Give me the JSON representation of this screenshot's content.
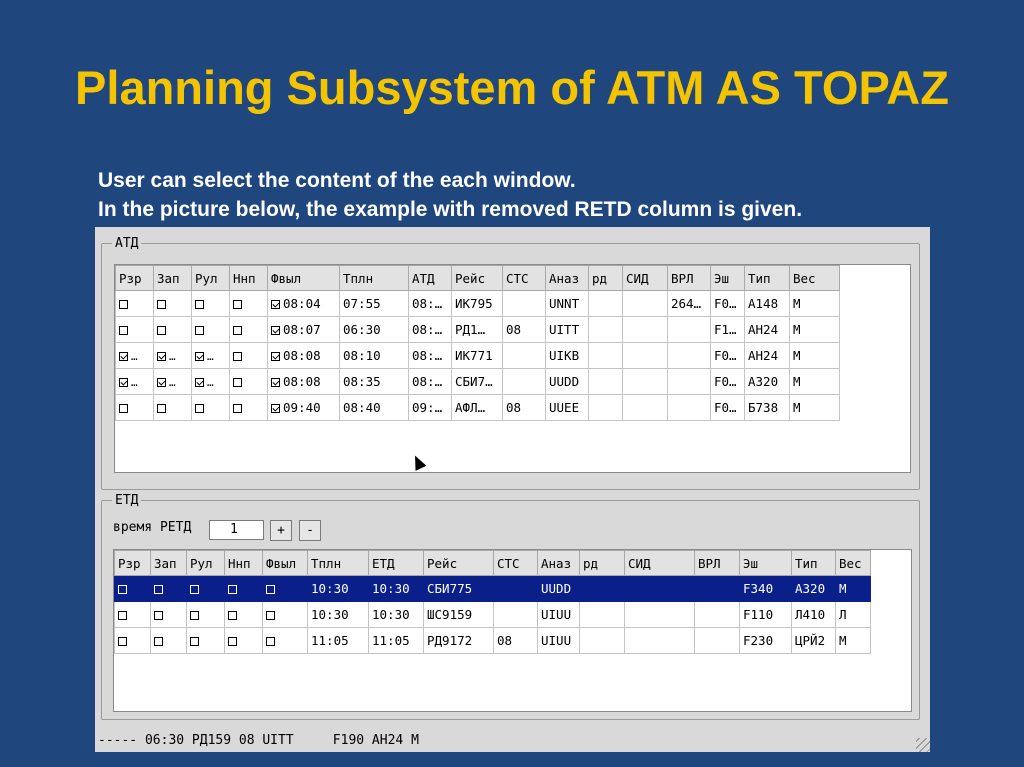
{
  "slide": {
    "title": "Planning Subsystem of ATM AS TOPAZ",
    "line1": "User can select the content of the each window.",
    "line2": "In the picture below, the example with removed RETD column is given."
  },
  "atd": {
    "legend": "АТД",
    "columns": [
      "Рзр",
      "Зап",
      "Рул",
      "Ннп",
      "Фвыл",
      "Тплн",
      "АТД",
      "Рейс",
      "СТС",
      "Аназ",
      "рд",
      "СИД",
      "ВРЛ",
      "Эш",
      "Тип",
      "Вес"
    ],
    "rows": [
      {
        "rzr": false,
        "zap": false,
        "rul": false,
        "nnp": false,
        "fvyl": "08:04",
        "tpln": "07:55",
        "atd": "08:…",
        "reys": "ИК795",
        "sts": "",
        "anaz": "UNNT",
        "rd": "",
        "sid": "",
        "vrl": "264…",
        "esh": "F0…",
        "tip": "A148",
        "ves": "М"
      },
      {
        "rzr": false,
        "zap": false,
        "rul": false,
        "nnp": false,
        "fvyl": "08:07",
        "tpln": "06:30",
        "atd": "08:…",
        "reys": "РД1…",
        "sts": "08",
        "anaz": "UITT",
        "rd": "",
        "sid": "",
        "vrl": "",
        "esh": "F1…",
        "tip": "АН24",
        "ves": "М"
      },
      {
        "rzr": true,
        "zap": true,
        "rul": true,
        "nnp": false,
        "fvyl": "08:08",
        "tpln": "08:10",
        "atd": "08:…",
        "reys": "ИК771",
        "sts": "",
        "anaz": "UIKB",
        "rd": "",
        "sid": "",
        "vrl": "",
        "esh": "F0…",
        "tip": "АН24",
        "ves": "М"
      },
      {
        "rzr": true,
        "zap": true,
        "rul": true,
        "nnp": false,
        "fvyl": "08:08",
        "tpln": "08:35",
        "atd": "08:…",
        "reys": "СБИ7…",
        "sts": "",
        "anaz": "UUDD",
        "rd": "",
        "sid": "",
        "vrl": "",
        "esh": "F0…",
        "tip": "A320",
        "ves": "М"
      },
      {
        "rzr": false,
        "zap": false,
        "rul": false,
        "nnp": false,
        "fvyl": "09:40",
        "tpln": "08:40",
        "atd": "09:…",
        "reys": "АФЛ…",
        "sts": "08",
        "anaz": "UUEE",
        "rd": "",
        "sid": "",
        "vrl": "",
        "esh": "F0…",
        "tip": "Б738",
        "ves": "М"
      }
    ]
  },
  "etd": {
    "legend": "ЕТД",
    "retd_label": "время РЕТД",
    "retd_value": "1",
    "plus": "+",
    "minus": "-",
    "columns": [
      "Рзр",
      "Зап",
      "Рул",
      "Ннп",
      "Фвыл",
      "Тплн",
      "ЕТД",
      "Рейс",
      "СТС",
      "Аназ",
      "рд",
      "СИД",
      "ВРЛ",
      "Эш",
      "Тип",
      "Вес"
    ],
    "rows": [
      {
        "tpln": "10:30",
        "etd": "10:30",
        "reys": "СБИ775",
        "sts": "",
        "anaz": "UUDD",
        "rd": "",
        "sid": "",
        "vrl": "",
        "esh": "F340",
        "tip": "A320",
        "ves": "М",
        "selected": true
      },
      {
        "tpln": "10:30",
        "etd": "10:30",
        "reys": "ШС9159",
        "sts": "",
        "anaz": "UIUU",
        "rd": "",
        "sid": "",
        "vrl": "",
        "esh": "F110",
        "tip": "Л410",
        "ves": "Л",
        "selected": false
      },
      {
        "tpln": "11:05",
        "etd": "11:05",
        "reys": "РД9172",
        "sts": "08",
        "anaz": "UIUU",
        "rd": "",
        "sid": "",
        "vrl": "",
        "esh": "F230",
        "tip": "ЦРЙ2",
        "ves": "М",
        "selected": false
      }
    ]
  },
  "status": "----- 06:30 РД159 08 UITT     F190 АН24 М",
  "colors": {
    "background": "#1f477e",
    "title": "#f5c400",
    "highlight_green": "#22e022",
    "highlight_yellow": "#ffff00",
    "selected_row": "#0a1f8a"
  }
}
